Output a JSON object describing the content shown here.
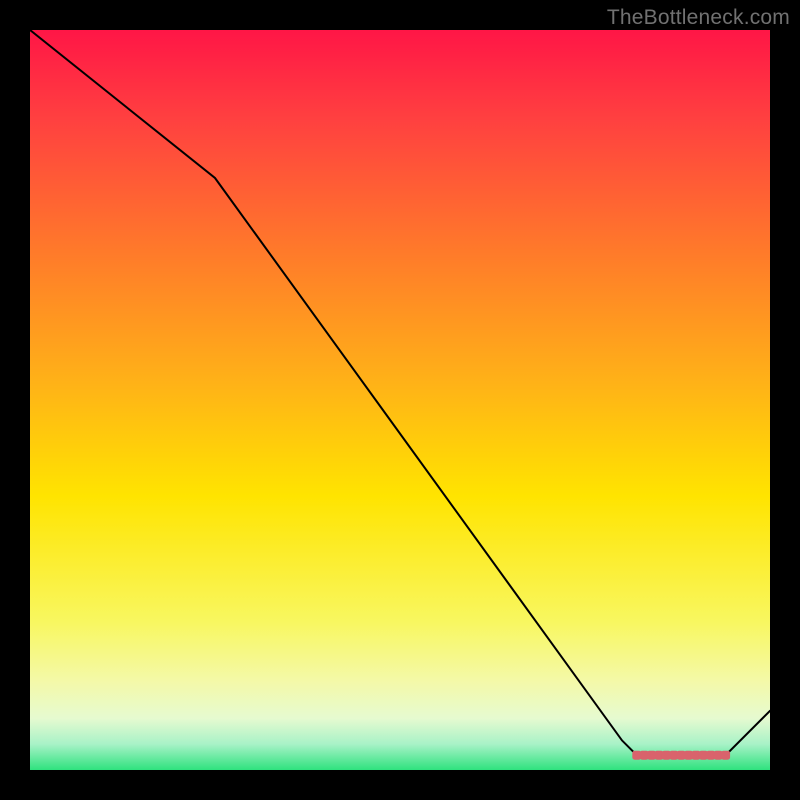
{
  "attribution": "TheBottleneck.com",
  "chart_data": {
    "type": "line",
    "x": [
      0.0,
      0.25,
      0.8,
      0.82,
      0.94,
      1.0
    ],
    "values": [
      1.0,
      0.8,
      0.04,
      0.02,
      0.02,
      0.08
    ],
    "xlim": [
      0,
      1
    ],
    "ylim": [
      0,
      1
    ],
    "gradient_colors": [
      "#ff1646",
      "#ff4040",
      "#ff7a2a",
      "#ffb317",
      "#ffe400",
      "#f8f760",
      "#f4f9a8",
      "#e6fad0",
      "#a8f2c7",
      "#2fe27e"
    ],
    "line_color": "#000000",
    "marker_color": "#d9636c",
    "marker_segment": {
      "x_start": 0.82,
      "x_end": 0.94
    }
  }
}
